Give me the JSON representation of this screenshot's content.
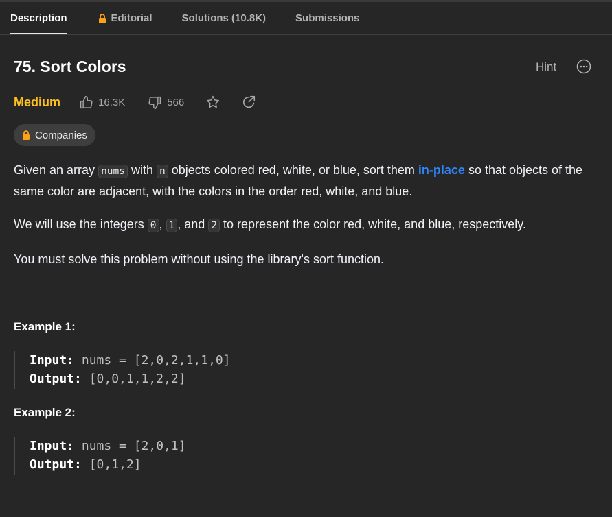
{
  "tabs": [
    {
      "label": "Description"
    },
    {
      "label": "Editorial"
    },
    {
      "label": "Solutions (10.8K)"
    },
    {
      "label": "Submissions"
    }
  ],
  "problem": {
    "title": "75. Sort Colors",
    "hint_label": "Hint",
    "difficulty": "Medium",
    "likes": "16.3K",
    "dislikes": "566",
    "companies_label": "Companies"
  },
  "description": {
    "p1": {
      "t1": "Given an array ",
      "c1": "nums",
      "t2": " with ",
      "c2": "n",
      "t3": " objects colored red, white, or blue, sort them ",
      "link": "in-place",
      "t4": " so that objects of the same color are adjacent, with the colors in the order red, white, and blue."
    },
    "p2": {
      "t1": "We will use the integers ",
      "c1": "0",
      "t2": ", ",
      "c2": "1",
      "t3": ", and ",
      "c3": "2",
      "t4": " to represent the color red, white, and blue, respectively."
    },
    "p3": "You must solve this problem without using the library's sort function."
  },
  "examples": [
    {
      "title": "Example 1:",
      "input_label": "Input:",
      "input": " nums = [2,0,2,1,1,0]",
      "output_label": "Output:",
      "output": " [0,0,1,1,2,2]"
    },
    {
      "title": "Example 2:",
      "input_label": "Input:",
      "input": " nums = [2,0,1]",
      "output_label": "Output:",
      "output": " [0,1,2]"
    }
  ],
  "colors": {
    "accent_medium": "#ffc01e",
    "link": "#2e87ff",
    "lock": "#ffa116",
    "background": "#262626"
  },
  "icons": [
    "lock-icon",
    "thumbs-up-icon",
    "thumbs-down-icon",
    "star-icon",
    "share-icon",
    "more-options-icon"
  ]
}
